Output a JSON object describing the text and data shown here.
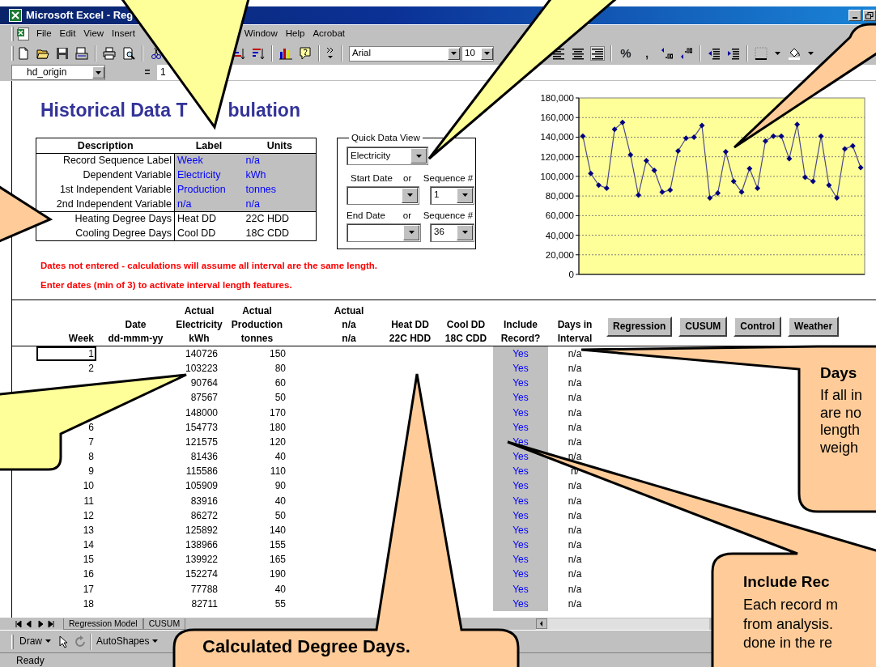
{
  "window": {
    "title": "Microsoft Excel - Reg"
  },
  "menu": [
    "File",
    "Edit",
    "View",
    "Insert",
    "Window",
    "Help",
    "Acrobat"
  ],
  "toolbar": {
    "font": "Arial",
    "size": "10",
    "percent": "%",
    "comma": ","
  },
  "formula_bar": {
    "name_box": "hd_origin",
    "equals": "=",
    "value": "1"
  },
  "sheet_title": [
    "Historical Data T",
    "bulation"
  ],
  "description_table": {
    "columns": [
      "Description",
      "Label",
      "Units"
    ],
    "rows": [
      {
        "description": "Record Sequence Label",
        "label": "Week",
        "units": "n/a",
        "editable": true
      },
      {
        "description": "Dependent Variable",
        "label": "Electricity",
        "units": "kWh",
        "editable": true
      },
      {
        "description": "1st Independent Variable",
        "label": "Production",
        "units": "tonnes",
        "editable": true
      },
      {
        "description": "2nd Independent Variable",
        "label": "n/a",
        "units": "n/a",
        "editable": true
      },
      {
        "description": "Heating Degree Days",
        "label": "Heat DD",
        "units": "22C HDD",
        "editable": false
      },
      {
        "description": "Cooling Degree Days",
        "label": "Cool DD",
        "units": "18C CDD",
        "editable": false
      }
    ]
  },
  "quick_data_view": {
    "title": "Quick Data View",
    "series": "Electricity",
    "start_label": "Start Date",
    "start_or": "or",
    "start_seq_label": "Sequence #",
    "start_seq": "1",
    "end_label": "End Date",
    "end_or": "or",
    "end_seq_label": "Sequence #",
    "end_seq": "36"
  },
  "notes": [
    "Dates not entered - calculations will assume all interval are the same length.",
    "Enter dates (min of 3) to activate interval length features."
  ],
  "chart_data": {
    "type": "line",
    "grid": true,
    "marker": "diamond",
    "values": [
      141000,
      103000,
      91000,
      88000,
      148000,
      155000,
      122000,
      81000,
      116000,
      106000,
      84000,
      86000,
      126000,
      139000,
      140000,
      152000,
      78000,
      83000,
      125000,
      95000,
      84000,
      108000,
      88000,
      136000,
      141000,
      141000,
      118000,
      153000,
      99000,
      95000,
      141000,
      91000,
      78000,
      128000,
      131000,
      109000
    ],
    "ylim": [
      0,
      180000
    ],
    "yticks": [
      {
        "value": 0,
        "label": "0"
      },
      {
        "value": 20000,
        "label": "20,000"
      },
      {
        "value": 40000,
        "label": "40,000"
      },
      {
        "value": 60000,
        "label": "60,000"
      },
      {
        "value": 80000,
        "label": "80,000"
      },
      {
        "value": 100000,
        "label": "100,000"
      },
      {
        "value": 120000,
        "label": "120,000"
      },
      {
        "value": 140000,
        "label": "140,000"
      },
      {
        "value": 160000,
        "label": "160,000"
      },
      {
        "value": 180000,
        "label": "180,000"
      }
    ]
  },
  "columns": [
    [
      "Week"
    ],
    [
      "Date",
      "dd-mmm-yy"
    ],
    [
      "Actual",
      "Electricity",
      "kWh"
    ],
    [
      "Actual",
      "Production",
      "tonnes"
    ],
    [
      "Actual",
      "n/a",
      "n/a"
    ],
    [
      "Heat DD",
      "22C HDD"
    ],
    [
      "Cool DD",
      "18C CDD"
    ],
    [
      "Include",
      "Record?"
    ],
    [
      "Days in",
      "Interval"
    ]
  ],
  "buttons": [
    "Regression",
    "CUSUM",
    "Control",
    "Weather"
  ],
  "rows": [
    {
      "selected": true,
      "week": "1",
      "electricity": "140726",
      "production": "150",
      "include": "Yes",
      "days": "n/a"
    },
    {
      "selected": false,
      "week": "2",
      "electricity": "103223",
      "production": "80",
      "include": "Yes",
      "days": "n/a"
    },
    {
      "electricity": "90764",
      "production": "60",
      "include": "Yes",
      "days": "n/a"
    },
    {
      "electricity": "87567",
      "production": "50",
      "include": "Yes",
      "days": "n/a"
    },
    {
      "electricity": "148000",
      "production": "170",
      "include": "Yes",
      "days": "n/a"
    },
    {
      "selected": false,
      "week": "6",
      "electricity": "154773",
      "production": "180",
      "include": "Yes",
      "days": "n/a"
    },
    {
      "selected": false,
      "week": "7",
      "electricity": "121575",
      "production": "120",
      "include": "Yes",
      "days": "n/a"
    },
    {
      "selected": false,
      "week": "8",
      "electricity": "81436",
      "production": "40",
      "include": "Yes",
      "days": "n/a"
    },
    {
      "selected": false,
      "week": "9",
      "electricity": "115586",
      "production": "110",
      "include": "Yes",
      "days": "n/"
    },
    {
      "selected": false,
      "week": "10",
      "electricity": "105909",
      "production": "90",
      "include": "Yes",
      "days": "n/a"
    },
    {
      "selected": false,
      "week": "11",
      "electricity": "83916",
      "production": "40",
      "include": "Yes",
      "days": "n/a"
    },
    {
      "selected": false,
      "week": "12",
      "electricity": "86272",
      "production": "50",
      "include": "Yes",
      "days": "n/a"
    },
    {
      "selected": false,
      "week": "13",
      "electricity": "125892",
      "production": "140",
      "include": "Yes",
      "days": "n/a"
    },
    {
      "selected": false,
      "week": "14",
      "electricity": "138966",
      "production": "155",
      "include": "Yes",
      "days": "n/a"
    },
    {
      "selected": false,
      "week": "15",
      "electricity": "139922",
      "production": "165",
      "include": "Yes",
      "days": "n/a"
    },
    {
      "selected": false,
      "week": "16",
      "electricity": "152274",
      "production": "190",
      "include": "Yes",
      "days": "n/a"
    },
    {
      "selected": false,
      "week": "17",
      "electricity": "77788",
      "production": "40",
      "include": "Yes",
      "days": "n/a"
    },
    {
      "selected": false,
      "week": "18",
      "electricity": "82711",
      "production": "55",
      "include": "Yes",
      "days": "n/a"
    }
  ],
  "sheet_tabs": [
    {
      "label": "Regression Model",
      "selected": false
    },
    {
      "label": "CUSUM",
      "selected": false
    }
  ],
  "drawing_toolbar": [
    "Draw",
    "AutoShapes"
  ],
  "status_bar": "Ready",
  "callouts": [
    {
      "color": "#ffff99"
    },
    {
      "color": "#ffff99"
    },
    {
      "color": "#ffcc99"
    },
    {
      "color": "#ffcc99"
    },
    {
      "color": "#ffff99"
    },
    {
      "color": "#ffcc99",
      "heading": "Days",
      "lines": [
        "If all in",
        "are no",
        "length",
        "weigh"
      ]
    },
    {
      "color": "#ffcc99",
      "heading": "Include Rec",
      "lines": [
        "Each record m",
        "from analysis.",
        "done in the re"
      ]
    },
    {
      "color": "#ffcc99",
      "heading": "Calculated Degree Days."
    }
  ]
}
